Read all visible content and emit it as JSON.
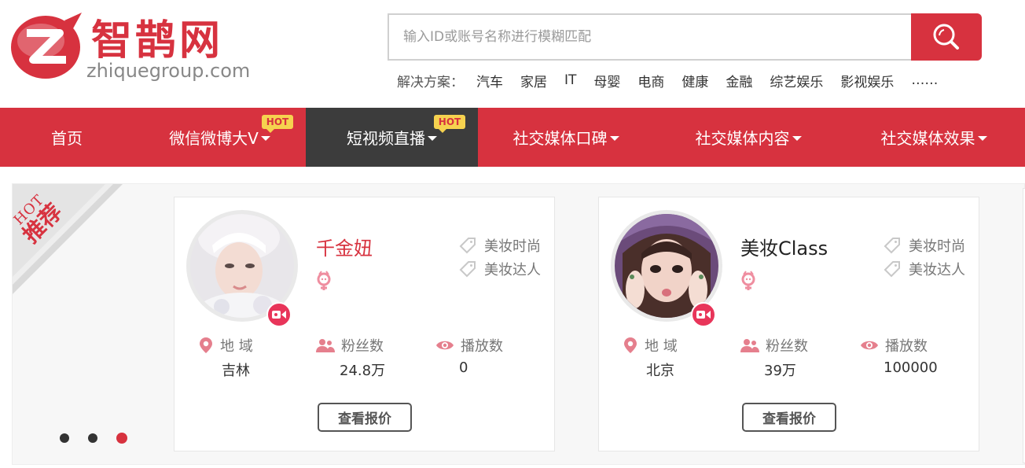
{
  "logo": {
    "text_cn": "智鹊网",
    "text_en_prefix": "zhique",
    "text_en_suffix": "group.com"
  },
  "search": {
    "placeholder": "输入ID或账号名称进行模糊匹配"
  },
  "solutions": {
    "label": "解决方案：",
    "items": [
      "汽车",
      "家居",
      "IT",
      "母婴",
      "电商",
      "健康",
      "金融",
      "综艺娱乐",
      "影视娱乐",
      "……"
    ]
  },
  "nav": {
    "items": [
      {
        "label": "首页"
      },
      {
        "label": "微信微博大V",
        "hot": "HOT"
      },
      {
        "label": "短视频直播",
        "hot": "HOT"
      },
      {
        "label": "社交媒体口碑"
      },
      {
        "label": "社交媒体内容"
      },
      {
        "label": "社交媒体效果"
      }
    ]
  },
  "corner": {
    "line1": "HOT",
    "line2": "推荐"
  },
  "stats_labels": {
    "region": "地 域",
    "fans": "粉丝数",
    "plays": "播放数"
  },
  "cards": [
    {
      "name": "千金妞",
      "name_color": "#d7323f",
      "tags": [
        "美妆时尚",
        "美妆达人"
      ],
      "region": "吉林",
      "fans": "24.8万",
      "plays": "0",
      "button": "查看报价"
    },
    {
      "name": "美妆Class",
      "name_color": "#222222",
      "tags": [
        "美妆时尚",
        "美妆达人"
      ],
      "region": "北京",
      "fans": "39万",
      "plays": "100000",
      "button": "查看报价"
    }
  ],
  "carousel": {
    "count": 3,
    "active": 3
  },
  "colors": {
    "brand": "#d7323f",
    "nav_active": "#3c3c3c",
    "hot_badge": "#f6d24f",
    "video_badge": "#e8355a"
  }
}
